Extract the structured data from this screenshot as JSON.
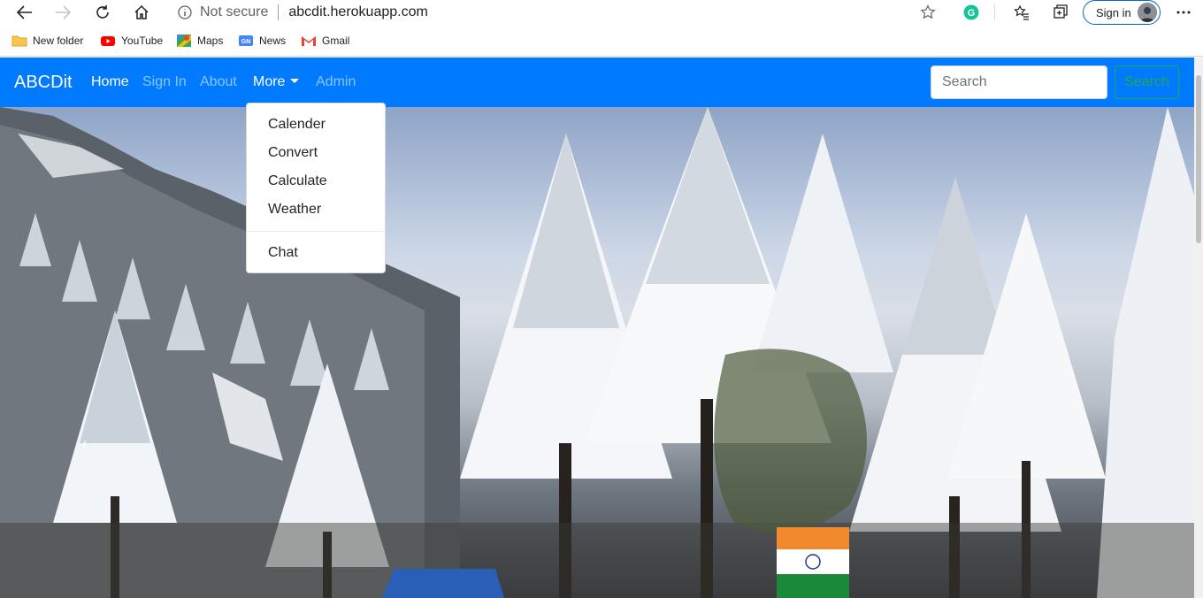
{
  "browser": {
    "security_text": "Not secure",
    "url": "abcdit.herokuapp.com",
    "signin_label": "Sign in",
    "bookmarks": [
      {
        "label": "New folder",
        "icon": "folder-icon"
      },
      {
        "label": "YouTube",
        "icon": "youtube-icon"
      },
      {
        "label": "Maps",
        "icon": "maps-icon"
      },
      {
        "label": "News",
        "icon": "news-icon"
      },
      {
        "label": "Gmail",
        "icon": "gmail-icon"
      }
    ]
  },
  "navbar": {
    "brand": "ABCDit",
    "links": [
      "Home",
      "Sign In",
      "About",
      "More",
      "Admin"
    ],
    "search_placeholder": "Search",
    "search_button": "Search",
    "color": "#007bff"
  },
  "dropdown": {
    "items": [
      "Calender",
      "Convert",
      "Calculate",
      "Weather"
    ],
    "extra": [
      "Chat"
    ]
  },
  "hero": {
    "prev_glyph": "‹"
  }
}
